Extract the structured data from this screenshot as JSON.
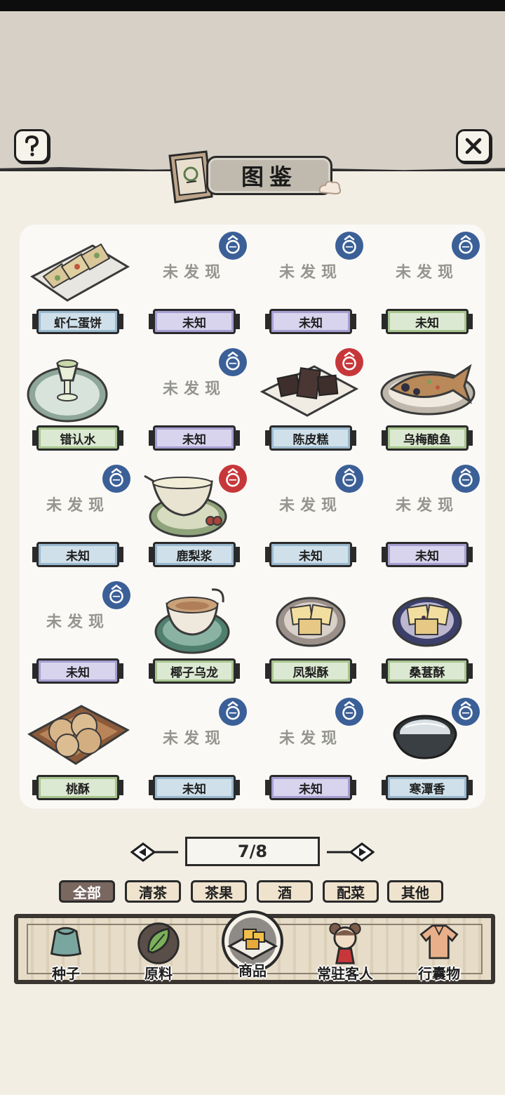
{
  "header": {
    "title": "图鉴"
  },
  "grid": {
    "undiscovered_text": "未发现",
    "items": [
      {
        "name": "虾仁蛋饼",
        "found": true,
        "badge": "",
        "label_color": "blue",
        "icon": "shrimp-omelette-icon"
      },
      {
        "name": "未知",
        "found": false,
        "badge": "blue",
        "label_color": "purple",
        "icon": "unknown-icon"
      },
      {
        "name": "未知",
        "found": false,
        "badge": "blue",
        "label_color": "purple",
        "icon": "unknown-icon"
      },
      {
        "name": "未知",
        "found": false,
        "badge": "blue",
        "label_color": "green",
        "icon": "unknown-icon"
      },
      {
        "name": "错认水",
        "found": true,
        "badge": "",
        "label_color": "green",
        "icon": "wine-cup-icon"
      },
      {
        "name": "未知",
        "found": false,
        "badge": "blue",
        "label_color": "purple",
        "icon": "unknown-icon"
      },
      {
        "name": "陈皮糕",
        "found": true,
        "badge": "red",
        "label_color": "blue",
        "icon": "dark-cake-icon"
      },
      {
        "name": "乌梅酿鱼",
        "found": true,
        "badge": "",
        "label_color": "green",
        "icon": "fish-dish-icon"
      },
      {
        "name": "未知",
        "found": false,
        "badge": "blue",
        "label_color": "blue",
        "icon": "unknown-icon"
      },
      {
        "name": "鹿梨浆",
        "found": true,
        "badge": "red",
        "label_color": "blue",
        "icon": "pear-drink-icon"
      },
      {
        "name": "未知",
        "found": false,
        "badge": "blue",
        "label_color": "blue",
        "icon": "unknown-icon"
      },
      {
        "name": "未知",
        "found": false,
        "badge": "blue",
        "label_color": "purple",
        "icon": "unknown-icon"
      },
      {
        "name": "未知",
        "found": false,
        "badge": "blue",
        "label_color": "purple",
        "icon": "unknown-icon"
      },
      {
        "name": "椰子乌龙",
        "found": true,
        "badge": "",
        "label_color": "green",
        "icon": "tea-cup-icon"
      },
      {
        "name": "凤梨酥",
        "found": true,
        "badge": "",
        "label_color": "green",
        "icon": "pastry-plate-icon"
      },
      {
        "name": "桑葚酥",
        "found": true,
        "badge": "",
        "label_color": "green",
        "icon": "pastry-plate-dark-icon"
      },
      {
        "name": "桃酥",
        "found": true,
        "badge": "",
        "label_color": "green",
        "icon": "cookie-tray-icon"
      },
      {
        "name": "未知",
        "found": false,
        "badge": "blue",
        "label_color": "blue",
        "icon": "unknown-icon"
      },
      {
        "name": "未知",
        "found": false,
        "badge": "blue",
        "label_color": "purple",
        "icon": "unknown-icon"
      },
      {
        "name": "寒潭香",
        "found": true,
        "badge": "blue",
        "label_color": "blue",
        "icon": "bowl-icon"
      }
    ]
  },
  "pager": {
    "text": "7/8"
  },
  "filters": [
    {
      "label": "全部",
      "active": true
    },
    {
      "label": "清茶",
      "active": false
    },
    {
      "label": "茶果",
      "active": false
    },
    {
      "label": "酒",
      "active": false
    },
    {
      "label": "配菜",
      "active": false
    },
    {
      "label": "其他",
      "active": false
    }
  ],
  "nav": [
    {
      "label": "种子",
      "icon": "seed-bag-icon"
    },
    {
      "label": "原料",
      "icon": "leaf-icon"
    },
    {
      "label": "商品",
      "icon": "product-plate-icon"
    },
    {
      "label": "常驻客人",
      "icon": "guest-girl-icon"
    },
    {
      "label": "行囊物",
      "icon": "robe-icon"
    }
  ],
  "colors": {
    "badge_blue": "#3b5f97",
    "badge_red": "#c7373a",
    "filter_active": "#7a6760",
    "panel_bg": "#faf9f6"
  }
}
